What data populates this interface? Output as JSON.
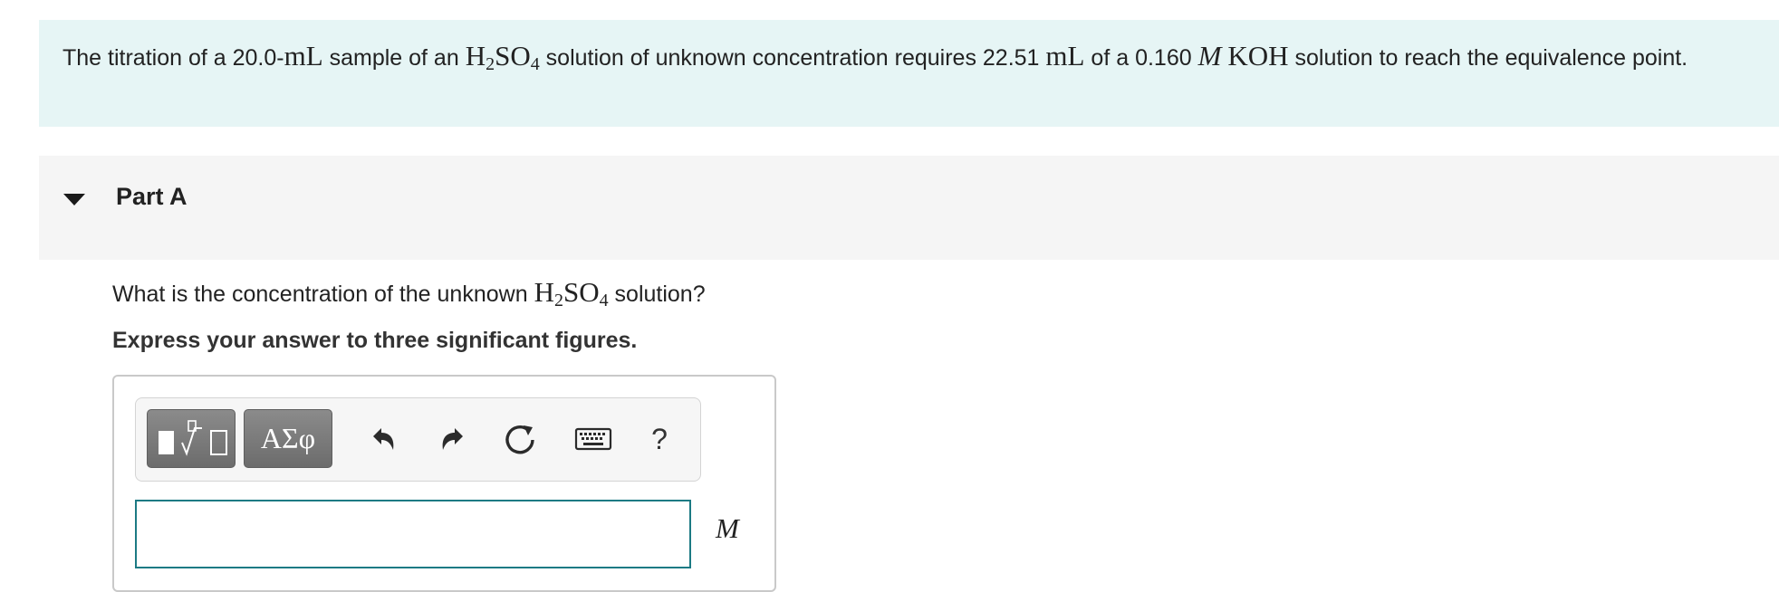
{
  "problem": {
    "t1": "The titration of a 20.0-",
    "u1": "mL",
    "t2": " sample of an ",
    "h": "H",
    "h_sub": "2",
    "so": "SO",
    "so_sub": "4",
    "t3": " solution of unknown concentration requires 22.51 ",
    "u2": "mL",
    "t4": " of a 0.160 ",
    "molar": "M",
    "koh": "KOH",
    "t5": " solution to reach the equivalence point."
  },
  "part": {
    "title": "Part A",
    "question_pre": "What is the concentration of the unknown ",
    "h": "H",
    "h_sub": "2",
    "so": "SO",
    "so_sub": "4",
    "question_post": " solution?",
    "instruction": "Express your answer to three significant figures."
  },
  "toolbar": {
    "greek_label": "ΑΣφ",
    "help_label": "?",
    "icons": [
      "templates-icon",
      "greek-letters-icon",
      "undo-icon",
      "redo-icon",
      "reset-icon",
      "keyboard-icon",
      "help-icon"
    ]
  },
  "answer": {
    "value": "",
    "unit": "M"
  },
  "colors": {
    "problem_bg": "#e6f5f5",
    "part_header_bg": "#f5f5f5",
    "input_border": "#1c7a84"
  }
}
